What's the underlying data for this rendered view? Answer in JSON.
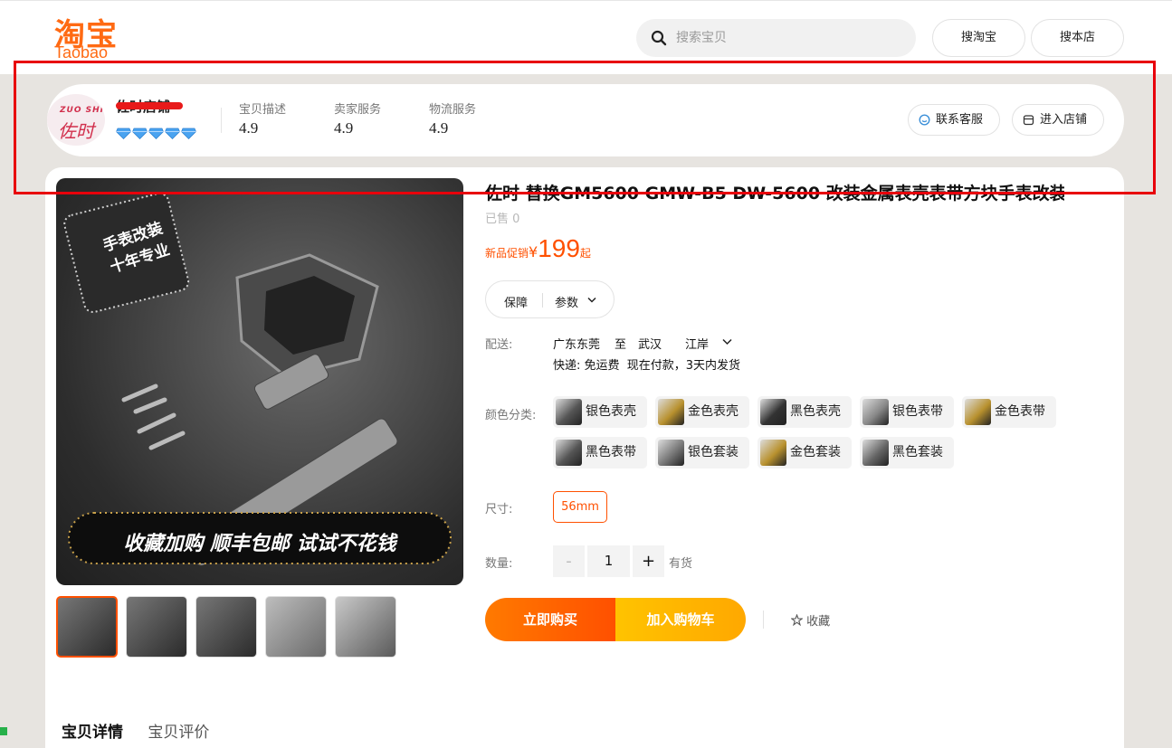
{
  "header": {
    "logo_cn": "淘宝",
    "logo_en": "Taobao",
    "search_placeholder": "搜索宝贝",
    "search_taobao": "搜淘宝",
    "search_shop": "搜本店"
  },
  "shop": {
    "avatar_en": "ZUO SHI",
    "avatar_cn": "佐时",
    "name": "佐时店铺",
    "level_diamonds": 5,
    "scores": [
      {
        "label": "宝贝描述",
        "value": "4.9"
      },
      {
        "label": "卖家服务",
        "value": "4.9"
      },
      {
        "label": "物流服务",
        "value": "4.9"
      }
    ],
    "contact": "联系客服",
    "enter_shop": "进入店铺"
  },
  "product": {
    "title": "佐时 替换GM5600 GMW-B5 DW-5600 改装金属表壳表带方块手表改装配件",
    "sold": "已售 0",
    "price_label": "新品促销",
    "currency": "¥",
    "price": "199",
    "price_suffix": "起",
    "tab_guarantee": "保障",
    "tab_params": "参数",
    "image_badge": "手表改装\n十年专业",
    "image_banner": "收藏加购 顺丰包邮 试试不花钱",
    "thumbnails": 5
  },
  "delivery": {
    "label": "配送:",
    "from": "广东东莞",
    "to_word": "至",
    "to_city": "武汉",
    "district": "江岸",
    "shipping": "快递: 免运费  现在付款，3天内发货"
  },
  "color": {
    "label": "颜色分类:",
    "options": [
      "银色表壳",
      "金色表壳",
      "黑色表壳",
      "银色表带",
      "金色表带",
      "黑色表带",
      "银色套装",
      "金色套装",
      "黑色套装"
    ]
  },
  "size": {
    "label": "尺寸:",
    "value": "56mm"
  },
  "quantity": {
    "label": "数量:",
    "value": "1",
    "minus": "-",
    "plus": "+",
    "stock": "有货"
  },
  "actions": {
    "buy_now": "立即购买",
    "add_cart": "加入购物车",
    "favorite": "收藏"
  },
  "detail_tabs": {
    "details": "宝贝详情",
    "reviews": "宝贝评价"
  },
  "colors": {
    "accent": "#ff5000",
    "highlight_box": "#e8000b",
    "diamond": "#4aa3f0"
  }
}
